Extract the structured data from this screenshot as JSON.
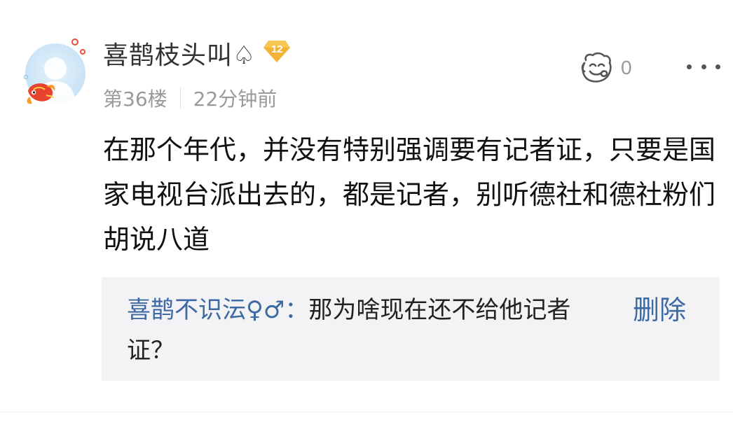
{
  "comment": {
    "username": "喜鹊枝头叫♤",
    "level": "12",
    "floor": "第36楼",
    "time": "22分钟前",
    "like_count": "0",
    "body": "在那个年代，并没有特别强调要有记者证，只要是国家电视台派出去的，都是记者，别听德社和德社粉们胡说八道"
  },
  "reply": {
    "author": "喜鹊不识沄♀♂",
    "separator": "：",
    "text": "那为啥现在还不给他记者证？",
    "delete_label": "删除"
  },
  "colors": {
    "link_blue": "#3d6aa3",
    "meta_gray": "#999999",
    "badge_gold": "#f2b233",
    "reply_bg": "#f3f3f5"
  },
  "icons": {
    "like": "thumbs-up-face-icon",
    "more": "more-dots-icon",
    "badge": "level-diamond-icon"
  }
}
